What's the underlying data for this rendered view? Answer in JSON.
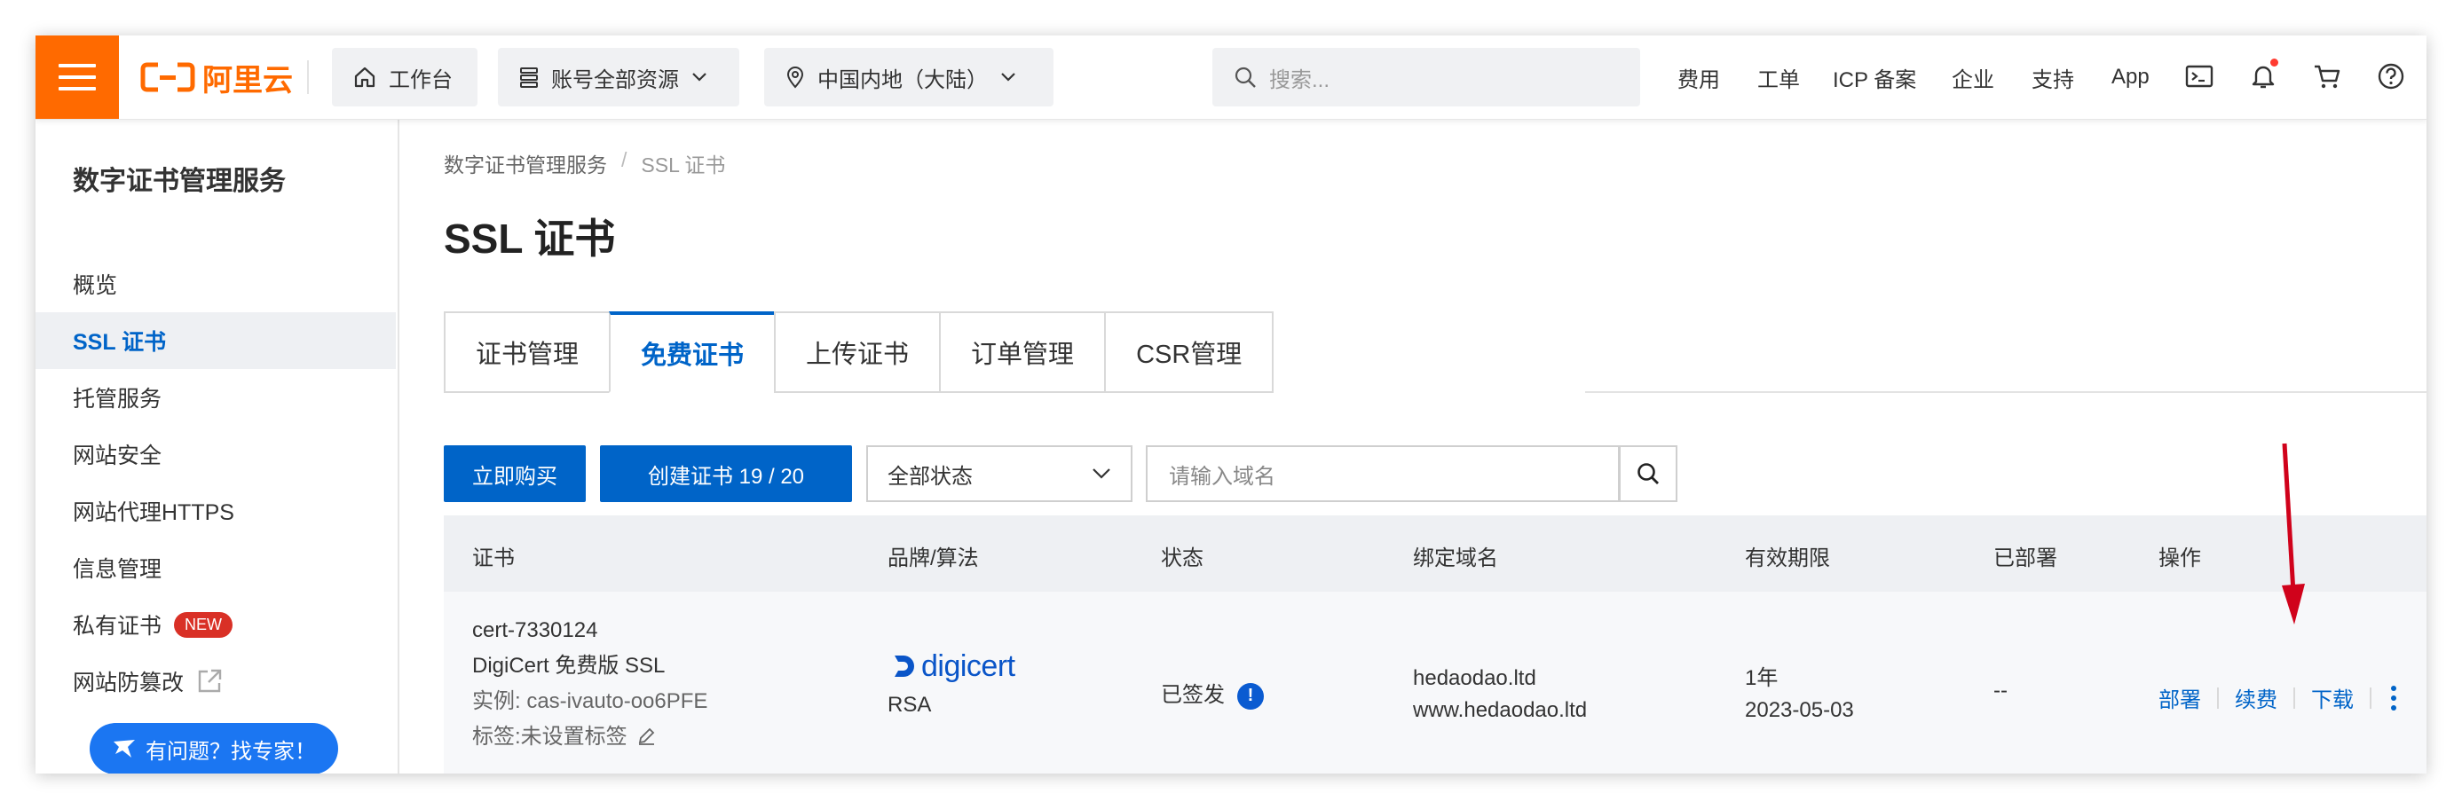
{
  "topbar": {
    "logo_text": "阿里云",
    "workbench": "工作台",
    "resources": "账号全部资源",
    "region": "中国内地（大陆）",
    "search_placeholder": "搜索...",
    "nav": [
      "费用",
      "工单",
      "ICP 备案",
      "企业",
      "支持",
      "App"
    ],
    "brand_color": "#ff6a00"
  },
  "sidebar": {
    "title": "数字证书管理服务",
    "items": [
      {
        "label": "概览"
      },
      {
        "label": "SSL 证书",
        "active": true
      },
      {
        "label": "托管服务"
      },
      {
        "label": "网站安全"
      },
      {
        "label": "网站代理HTTPS"
      },
      {
        "label": "信息管理"
      },
      {
        "label": "私有证书",
        "badge": "NEW"
      },
      {
        "label": "网站防篡改"
      }
    ],
    "expert_button": "有问题？找专家！"
  },
  "main": {
    "breadcrumb": [
      "数字证书管理服务",
      "/",
      "SSL 证书"
    ],
    "title": "SSL 证书",
    "tabs": [
      "证书管理",
      "免费证书",
      "上传证书",
      "订单管理",
      "CSR管理"
    ],
    "active_tab": "免费证书",
    "buy_button": "立即购买",
    "create_button": "创建证书 19 / 20",
    "status_select": "全部状态",
    "domain_placeholder": "请输入域名",
    "table": {
      "headers": [
        "证书",
        "品牌/算法",
        "状态",
        "绑定域名",
        "有效期限",
        "已部署",
        "操作"
      ],
      "rows": [
        {
          "cert_id": "cert-7330124",
          "cert_name": "DigiCert 免费版 SSL",
          "instance": "实例: cas-ivauto-oo6PFE",
          "tags": "标签:未设置标签",
          "brand": "digicert",
          "algorithm": "RSA",
          "status": "已签发",
          "domains": [
            "hedaodao.ltd",
            "www.hedaodao.ltd"
          ],
          "validity": "1年",
          "expiry": "2023-05-03",
          "deployed": "--",
          "actions": [
            "部署",
            "续费",
            "下载"
          ]
        }
      ]
    }
  },
  "accent_color": "#0064c8",
  "annotation_color": "#d0021b"
}
